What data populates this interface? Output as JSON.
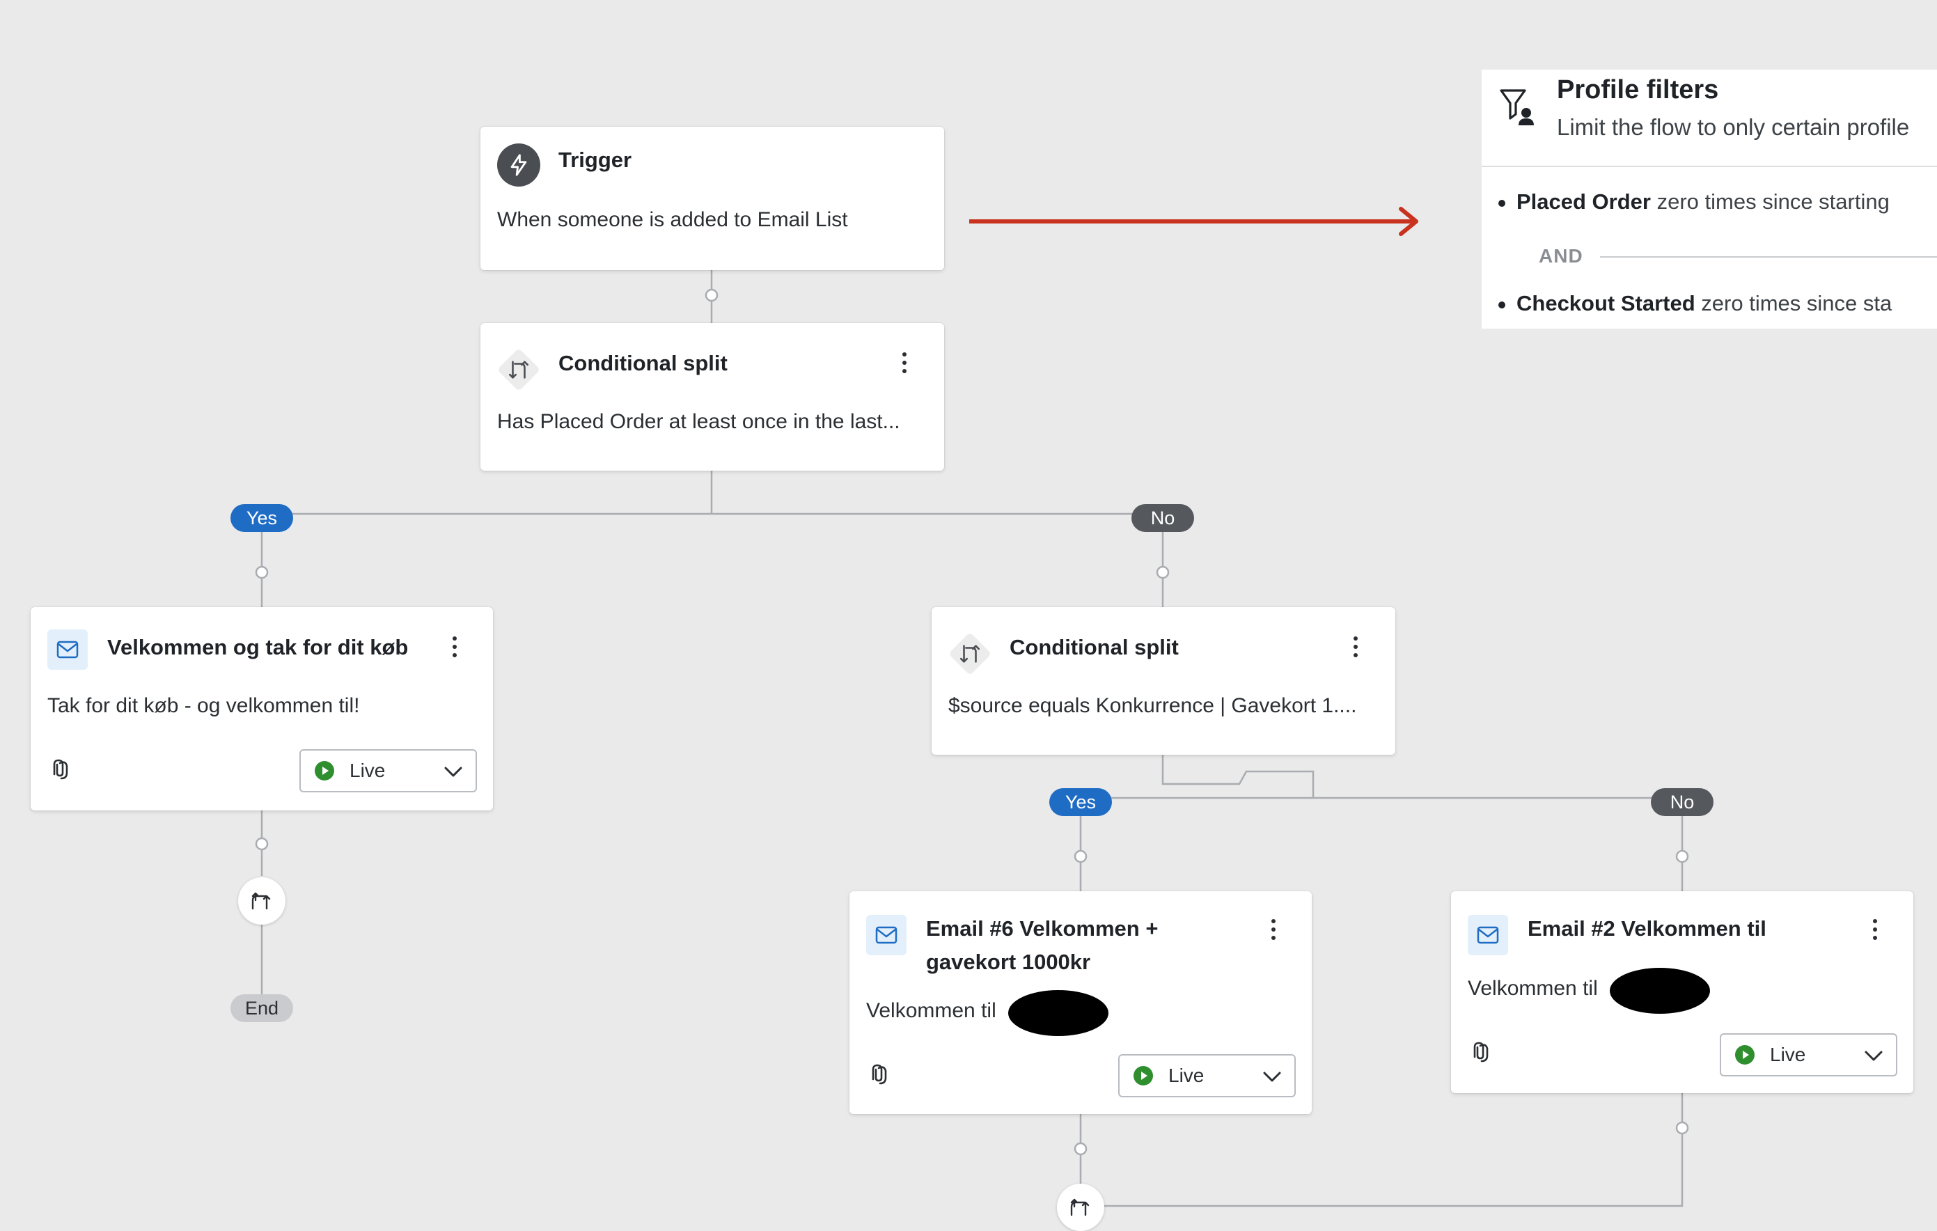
{
  "trigger": {
    "title": "Trigger",
    "description": "When someone is added to Email List",
    "icon": "lightning-icon"
  },
  "split_1": {
    "title": "Conditional split",
    "description": "Has Placed Order at least once in the last...",
    "icon": "split-icon"
  },
  "branch_labels": {
    "yes": "Yes",
    "no": "No",
    "end": "End"
  },
  "email_welcome": {
    "title": "Velkommen og tak for dit køb",
    "description": "Tak for dit køb - og velkommen til!",
    "status": "Live",
    "icon": "mail-icon"
  },
  "split_2": {
    "title": "Conditional split",
    "description": "$source equals Konkurrence | Gavekort 1....",
    "icon": "split-icon"
  },
  "email_6": {
    "title_line1": "Email #6 Velkommen +",
    "title_line2": "gavekort 1000kr",
    "description": "Velkommen til",
    "status": "Live",
    "icon": "mail-icon"
  },
  "email_2": {
    "title": "Email #2 Velkommen til",
    "description": "Velkommen til",
    "status": "Live",
    "icon": "mail-icon"
  },
  "profile_filters": {
    "title": "Profile filters",
    "subtitle": "Limit the flow to only certain profile",
    "rule_1_bold": "Placed Order",
    "rule_1_rest": " zero times since starting",
    "and_label": "AND",
    "rule_2_bold": "Checkout Started",
    "rule_2_rest": " zero times since sta",
    "icon": "filter-user-icon"
  },
  "colors": {
    "canvas": "#eaeaea",
    "yes_pill": "#1f6cc4",
    "no_pill": "#55585c",
    "live": "#2f8f2f",
    "arrow": "#c8321e"
  }
}
